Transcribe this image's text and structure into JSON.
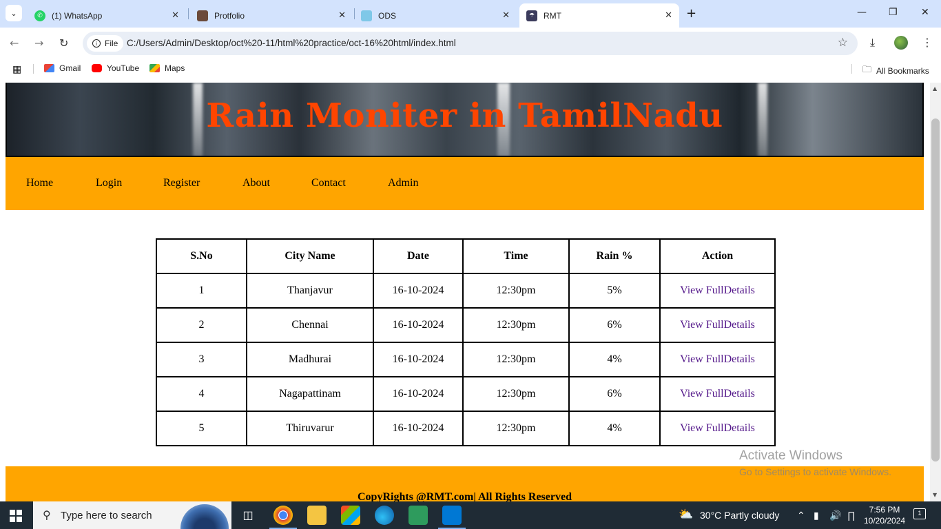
{
  "browser": {
    "tabs": [
      {
        "title": "(1) WhatsApp",
        "icon": "whatsapp-icon"
      },
      {
        "title": "Protfolio",
        "icon": "portfolio-favicon"
      },
      {
        "title": "ODS",
        "icon": "ods-favicon"
      },
      {
        "title": "RMT",
        "icon": "rmt-favicon",
        "active": true
      }
    ],
    "address_chip": "File",
    "url": "C:/Users/Admin/Desktop/oct%20-11/html%20practice/oct-16%20html/index.html",
    "bookmarks": [
      {
        "label": "Gmail",
        "icon": "gmail-icon"
      },
      {
        "label": "YouTube",
        "icon": "youtube-icon"
      },
      {
        "label": "Maps",
        "icon": "maps-icon"
      }
    ],
    "all_bookmarks": "All Bookmarks"
  },
  "page": {
    "title": "Rain Moniter in TamilNadu",
    "nav": [
      "Home",
      "Login",
      "Register",
      "About",
      "Contact",
      "Admin"
    ],
    "table": {
      "headers": [
        "S.No",
        "City Name",
        "Date",
        "Time",
        "Rain %",
        "Action"
      ],
      "rows": [
        {
          "sno": "1",
          "city": "Thanjavur",
          "date": "16-10-2024",
          "time": "12:30pm",
          "rain": "5%",
          "action": "View FullDetails"
        },
        {
          "sno": "2",
          "city": "Chennai",
          "date": "16-10-2024",
          "time": "12:30pm",
          "rain": "6%",
          "action": "View FullDetails"
        },
        {
          "sno": "3",
          "city": "Madhurai",
          "date": "16-10-2024",
          "time": "12:30pm",
          "rain": "4%",
          "action": "View FullDetails"
        },
        {
          "sno": "4",
          "city": "Nagapattinam",
          "date": "16-10-2024",
          "time": "12:30pm",
          "rain": "6%",
          "action": "View FullDetails"
        },
        {
          "sno": "5",
          "city": "Thiruvarur",
          "date": "16-10-2024",
          "time": "12:30pm",
          "rain": "4%",
          "action": "View FullDetails"
        }
      ]
    },
    "footer": "CopyRights @RMT.com| All Rights Reserved",
    "colors": {
      "title": "#ff4500",
      "nav_bg": "#ffa500",
      "link": "#551a8b"
    }
  },
  "watermark": {
    "line1": "Activate Windows",
    "line2": "Go to Settings to activate Windows."
  },
  "taskbar": {
    "search_placeholder": "Type here to search",
    "weather": "30°C  Partly cloudy",
    "time": "7:56 PM",
    "date": "10/20/2024",
    "notifications": "1"
  }
}
